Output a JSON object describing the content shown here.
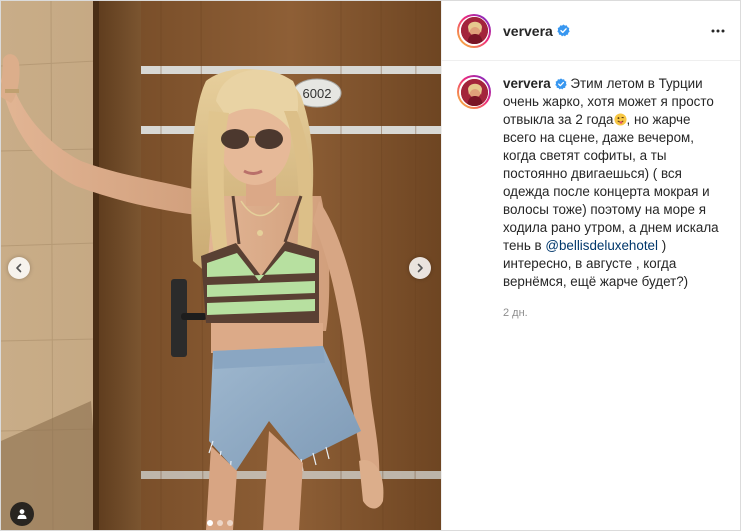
{
  "post": {
    "username": "ververa",
    "verified": true,
    "caption_part1": "Этим летом в Турции очень жарко, хотя может я просто отвыкла за 2 года",
    "caption_emoji": "winking-tongue-emoji",
    "caption_part2": ", но жарче всего на сцене, даже вечером, когда светят софиты, а ты постоянно двигаешься) ( вся одежда после концерта мокрая и волосы тоже) поэтому на море я ходила рано утром, а днем искала тень в ",
    "mention": "@bellisdeluxehotel",
    "caption_part3": " ) интересно, в августе , когда вернёмся, ещё жарче будет?)",
    "timestamp": "2 дн.",
    "door_number": "6002"
  },
  "carousel": {
    "total_slides": 3,
    "active_slide": 1
  },
  "icons": {
    "verified": "verified-badge-icon",
    "more": "more-options-icon",
    "prev": "chevron-left-icon",
    "next": "chevron-right-icon",
    "tag": "user-tag-icon"
  },
  "colors": {
    "verified_blue": "#3897f0",
    "mention": "#00376b",
    "timestamp": "#8e8e8e"
  }
}
